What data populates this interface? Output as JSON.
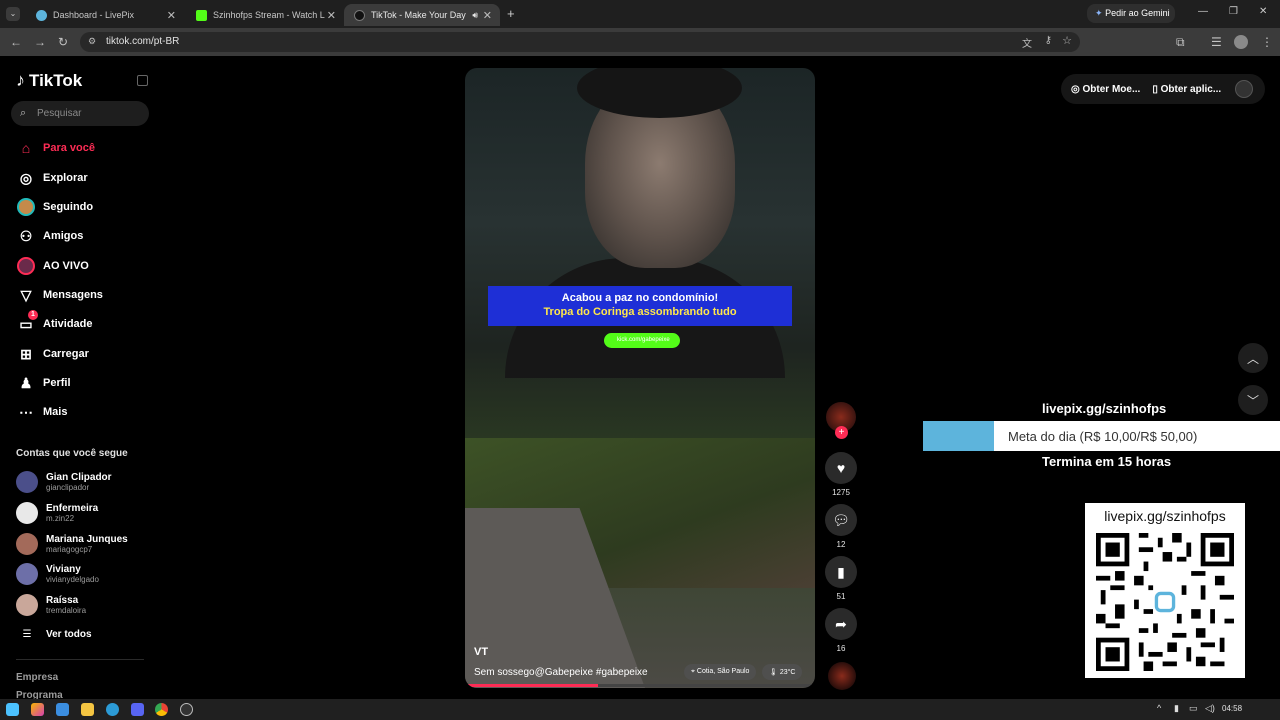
{
  "browser": {
    "tabs": [
      {
        "title": "Dashboard - LivePix",
        "active": false
      },
      {
        "title": "Szinhofps Stream - Watch Live o",
        "active": false
      },
      {
        "title": "TikTok - Make Your Day",
        "active": true
      }
    ],
    "new_tab": "+",
    "gemini": "Pedir ao Gemini",
    "url": "tiktok.com/pt-BR"
  },
  "tiktok": {
    "logo": "TikTok",
    "search_placeholder": "Pesquisar",
    "nav": [
      {
        "label": "Para você",
        "icon": "home-icon",
        "active": true
      },
      {
        "label": "Explorar",
        "icon": "compass-icon"
      },
      {
        "label": "Seguindo",
        "icon": "following-avatar-icon"
      },
      {
        "label": "Amigos",
        "icon": "friends-icon"
      },
      {
        "label": "AO VIVO",
        "icon": "live-icon"
      },
      {
        "label": "Mensagens",
        "icon": "send-icon"
      },
      {
        "label": "Atividade",
        "icon": "activity-icon",
        "badge": "1"
      },
      {
        "label": "Carregar",
        "icon": "upload-icon"
      },
      {
        "label": "Perfil",
        "icon": "profile-icon"
      },
      {
        "label": "Mais",
        "icon": "more-icon"
      }
    ],
    "following_title": "Contas que você segue",
    "following": [
      {
        "name": "Gian Clipador",
        "handle": "gianclipador",
        "color": "#4b4f8a"
      },
      {
        "name": "Enfermeira",
        "handle": "m.zin22",
        "color": "#e8e8e8"
      },
      {
        "name": "Mariana Junques",
        "handle": "mariagogcp7",
        "color": "#a36a5a"
      },
      {
        "name": "Viviany",
        "handle": "vivianydelgado",
        "color": "#6d6fa8"
      },
      {
        "name": "Raíssa",
        "handle": "tremdaloira",
        "color": "#c9a79a"
      }
    ],
    "see_all": "Ver todos",
    "footer": [
      "Empresa",
      "Programa"
    ]
  },
  "video": {
    "banner_line1": "Acabou a paz no condomínio!",
    "banner_line2": "Tropa do Coringa assombrando tudo",
    "badge": "kick.com/gabepeixe",
    "author": "VT",
    "description": "Sem sossego@Gabepeixe #gabepeixe",
    "location": "Cotia, São Paulo",
    "temp": "23°C",
    "progress": 0.38
  },
  "actions": {
    "likes": "1275",
    "comments": "12",
    "saves": "51",
    "shares": "16"
  },
  "top_right": {
    "coins": "Obter Moe...",
    "app": "Obter aplic..."
  },
  "livepix": {
    "url": "livepix.gg/szinhofps",
    "goal": "Meta do dia (R$ 10,00/R$ 50,00)",
    "goal_fraction": 0.2,
    "ends": "Termina em 15 horas",
    "qr_title": "livepix.gg/szinhofps"
  },
  "taskbar": {
    "time": "04:58"
  },
  "colors": {
    "accent": "#fe2c55",
    "kick": "#53fc18",
    "livepix_bar": "#5db4dc"
  }
}
